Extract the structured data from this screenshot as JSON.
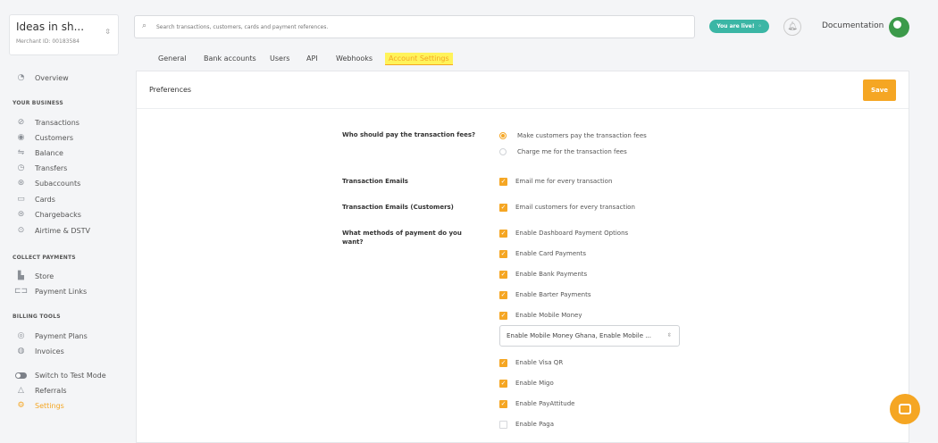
{
  "merchant": {
    "name": "Ideas in sh...",
    "id": "Merchant ID: 00183584"
  },
  "search": {
    "placeholder": "Search transactions, customers, cards and payment references."
  },
  "header": {
    "live_label": "You are live!  ◦",
    "docs_label": "Documentation"
  },
  "tabs": [
    "General",
    "Bank accounts",
    "Users",
    "API",
    "Webhooks",
    "Account Settings"
  ],
  "sidebar": {
    "overview": "Overview",
    "business_head": "YOUR BUSINESS",
    "business": [
      "Transactions",
      "Customers",
      "Balance",
      "Transfers",
      "Subaccounts",
      "Cards",
      "Chargebacks",
      "Airtime & DSTV"
    ],
    "collect_head": "COLLECT PAYMENTS",
    "collect": [
      "Store",
      "Payment Links"
    ],
    "billing_head": "BILLING TOOLS",
    "billing": [
      "Payment Plans",
      "Invoices"
    ],
    "extra": [
      "Switch to Test Mode",
      "Referrals",
      "Settings"
    ]
  },
  "card": {
    "title": "Preferences",
    "save_label": "Save"
  },
  "fees": {
    "question": "Who should pay the transaction fees?",
    "options": [
      "Make customers pay the transaction fees",
      "Charge me for the transaction fees"
    ]
  },
  "emails": {
    "label": "Transaction Emails",
    "option": "Email me for every transaction"
  },
  "customer_emails": {
    "label": "Transaction Emails (Customers)",
    "option": "Email customers for every transaction"
  },
  "methods": {
    "question": "What methods of payment do you want?",
    "options": [
      "Enable Dashboard Payment Options",
      "Enable Card Payments",
      "Enable Bank Payments",
      "Enable Barter Payments",
      "Enable Mobile Money"
    ],
    "select_value": "Enable Mobile Money Ghana, Enable Mobile ...",
    "more_options": [
      "Enable Visa QR",
      "Enable Migo",
      "Enable PayAttitude",
      "Enable Paga"
    ]
  },
  "colors": {
    "accent": "#f5a623",
    "live": "#3bb6a5",
    "tab_highlight": "#fff35a"
  }
}
